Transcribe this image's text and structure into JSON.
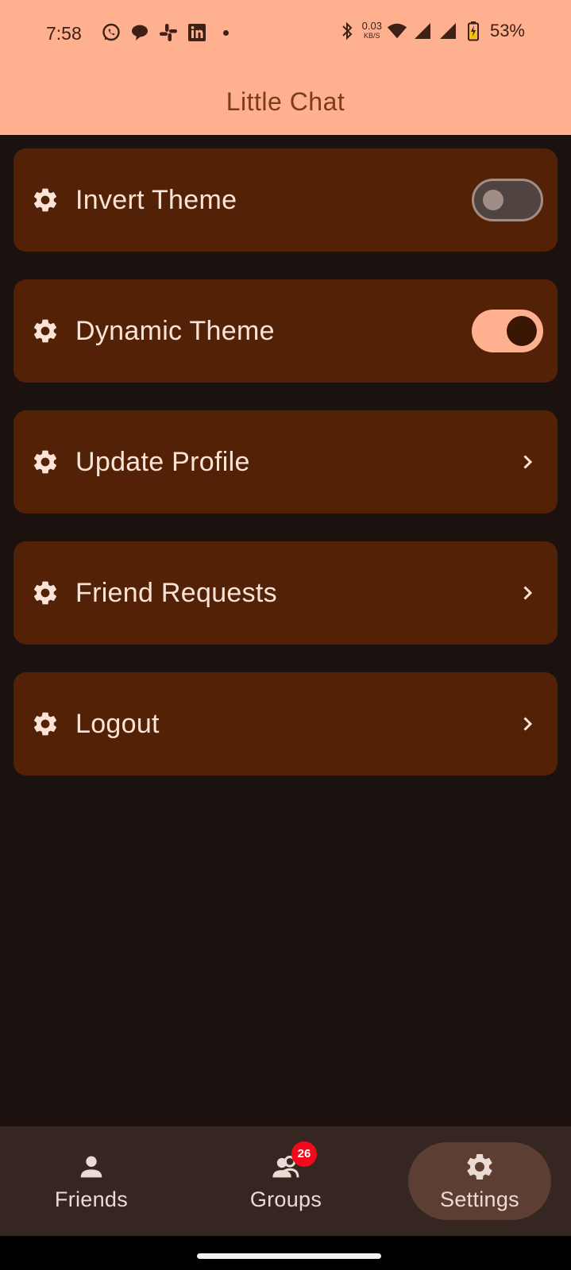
{
  "status_bar": {
    "time": "7:58",
    "notification_icons": [
      "whatsapp-icon",
      "chat-bubble-icon",
      "slack-icon",
      "linkedin-icon"
    ],
    "net_speed_value": "0.03",
    "net_speed_unit": "KB/S",
    "battery_percent": "53%"
  },
  "app_bar": {
    "title": "Little Chat"
  },
  "settings": {
    "items": [
      {
        "label": "Invert Theme",
        "control": "toggle",
        "checked": false
      },
      {
        "label": "Dynamic Theme",
        "control": "toggle",
        "checked": true
      },
      {
        "label": "Update Profile",
        "control": "chevron"
      },
      {
        "label": "Friend Requests",
        "control": "chevron"
      },
      {
        "label": "Logout",
        "control": "chevron"
      }
    ]
  },
  "bottom_nav": {
    "items": [
      {
        "label": "Friends",
        "icon": "person-icon",
        "selected": false
      },
      {
        "label": "Groups",
        "icon": "group-icon",
        "badge": "26",
        "selected": false
      },
      {
        "label": "Settings",
        "icon": "gear-icon",
        "selected": true
      }
    ]
  },
  "colors": {
    "header": "#ffb18f",
    "background": "#1b1210",
    "card": "#532206",
    "nav": "#352621",
    "badge": "#f4081a"
  }
}
